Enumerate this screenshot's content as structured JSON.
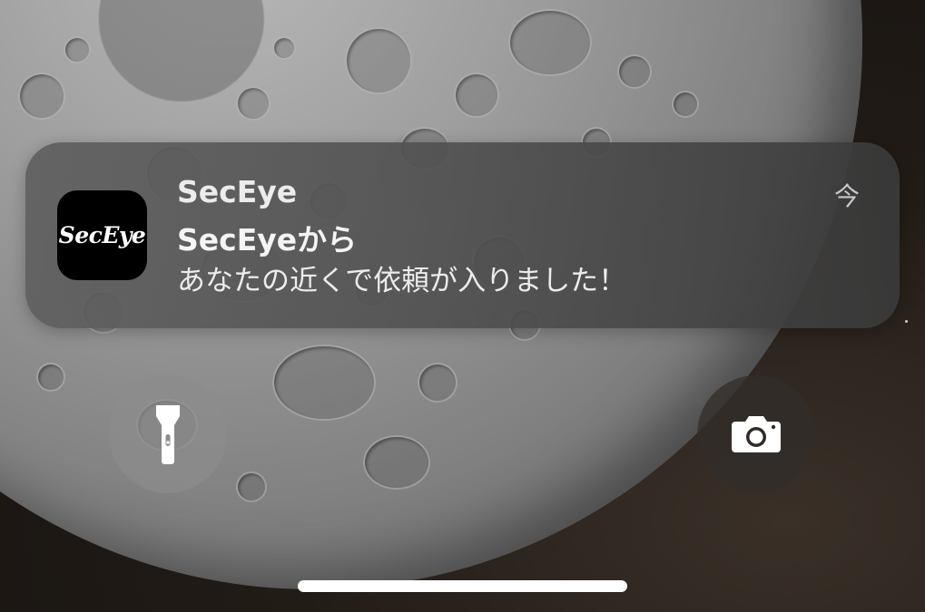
{
  "notification": {
    "app_icon_text": "SecEye",
    "app_name": "SecEye",
    "title": "SecEyeから",
    "body": "あなたの近くで依頼が入りました！",
    "time": "今"
  },
  "lock_screen": {
    "left_button_icon": "flashlight-icon",
    "right_button_icon": "camera-icon"
  }
}
